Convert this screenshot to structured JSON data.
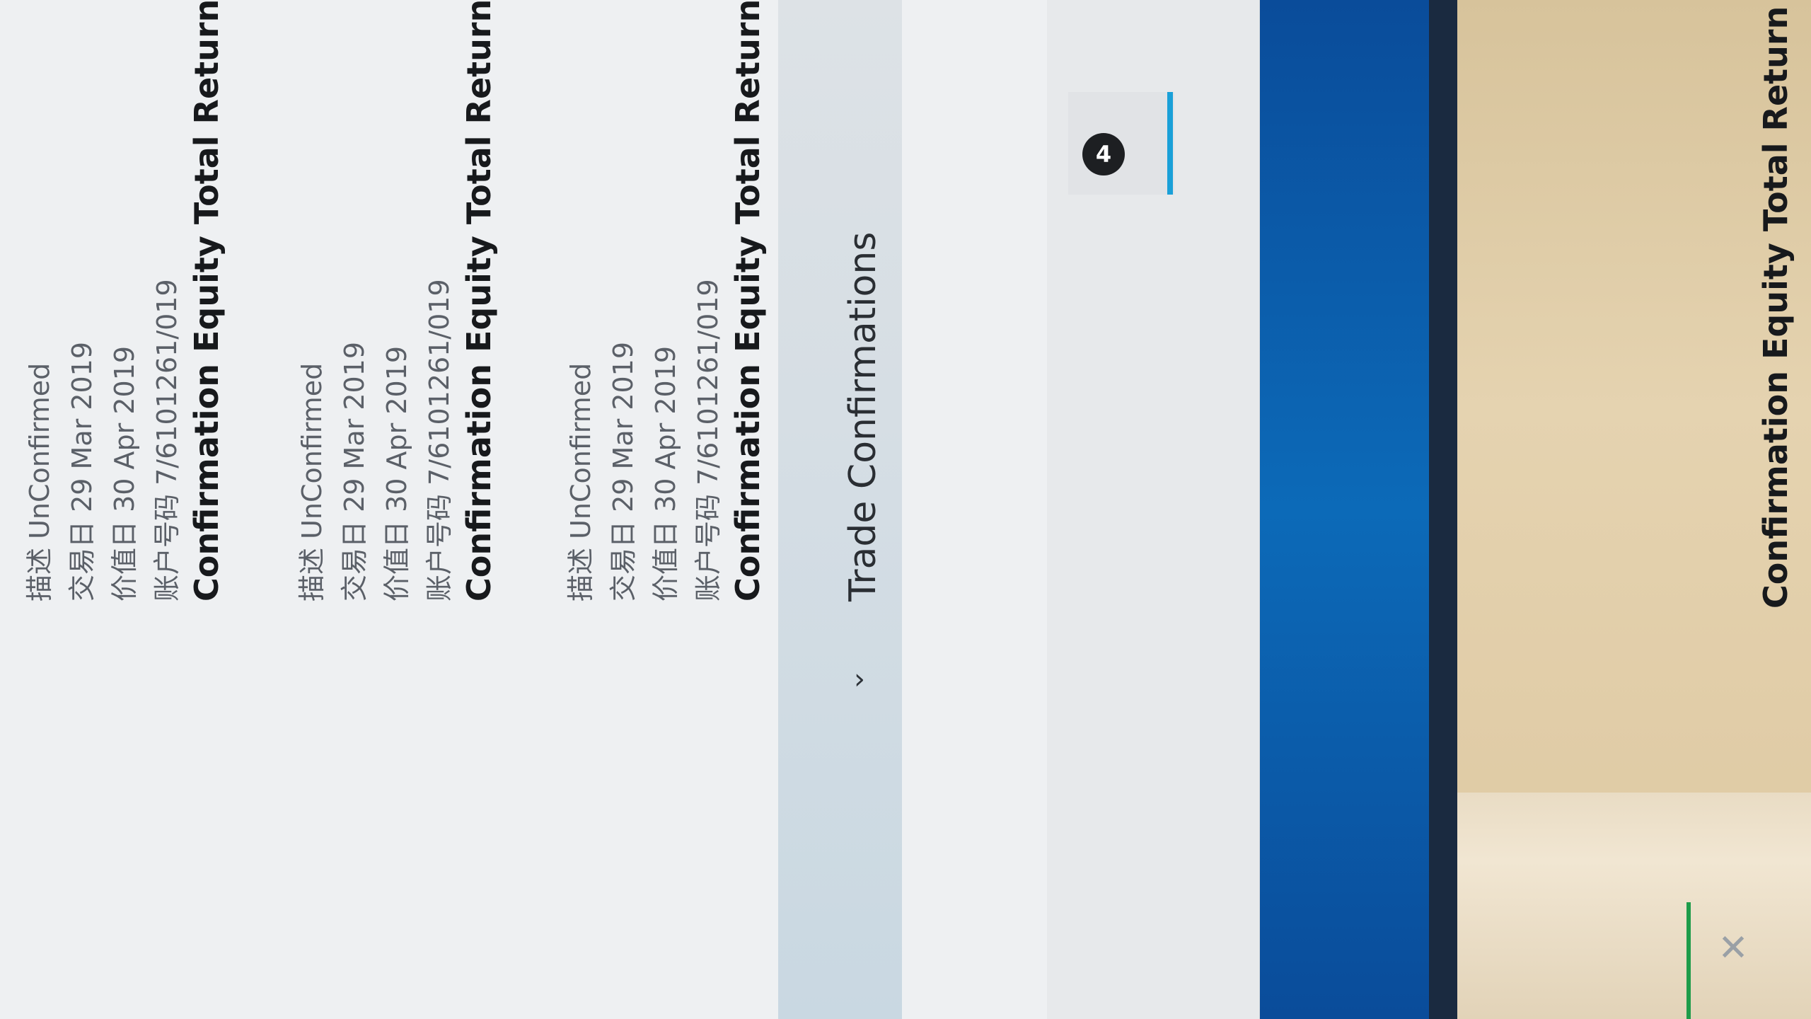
{
  "app": {
    "badge_count": "4",
    "panel_title": "Trade Confirmations"
  },
  "confirmations": [
    {
      "title": "Confirmation Equity Total Return Swap",
      "account_label": "账户号码",
      "account_value": "7/6101261/019",
      "value_date_label": "价值日",
      "value_date": "30 Apr 2019",
      "trade_date_label": "交易日",
      "trade_date": "29 Mar 2019",
      "description_label": "描述",
      "description": "UnConfirmed"
    },
    {
      "title": "Confirmation Equity Total Return Swap",
      "account_label": "账户号码",
      "account_value": "7/6101261/019",
      "value_date_label": "价值日",
      "value_date": "30 Apr 2019",
      "trade_date_label": "交易日",
      "trade_date": "29 Mar 2019",
      "description_label": "描述",
      "description": "UnConfirmed"
    },
    {
      "title": "Confirmation Equity Total Return Swap",
      "account_label": "账户号码",
      "account_value": "7/6101261/019",
      "value_date_label": "价值日",
      "value_date": "30 Apr 2019",
      "trade_date_label": "交易日",
      "trade_date": "29 Mar 2019",
      "description_label": "描述",
      "description": "UnConfirmed"
    },
    {
      "title": "Confirmation Equity Total Return Swap"
    }
  ],
  "colors": {
    "accent": "#1aa0d8",
    "os_bar": "#0c6ab8",
    "status_green": "#1e9c4a"
  },
  "icons": {
    "expand": "chevron-right-icon",
    "close": "close-icon"
  }
}
